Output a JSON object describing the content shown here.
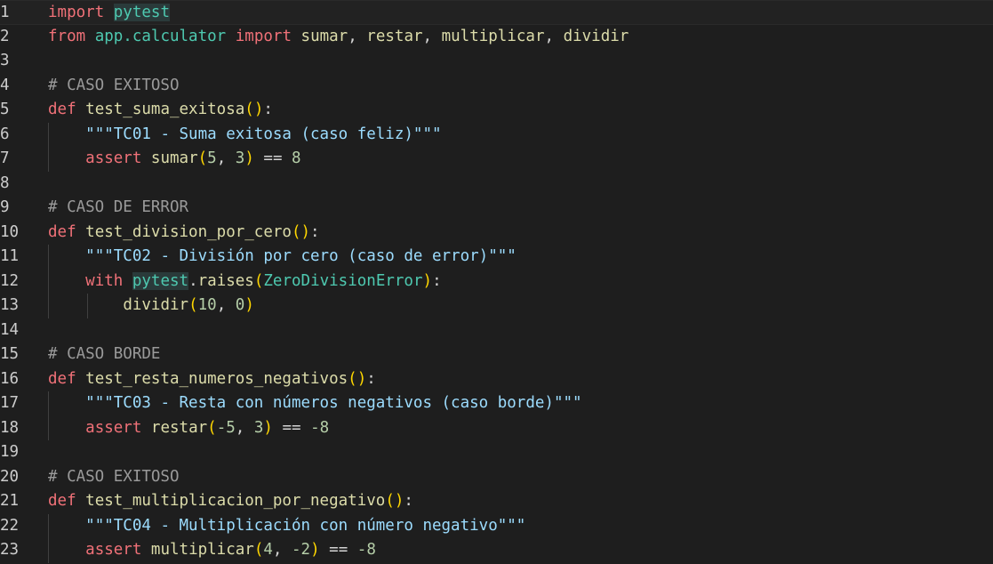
{
  "editor": {
    "lines": [
      {
        "n": "1",
        "tokens": [
          {
            "t": "import",
            "c": "kw"
          },
          {
            "t": " ",
            "c": "op"
          },
          {
            "t": "pytest",
            "c": "mod hl"
          }
        ]
      },
      {
        "n": "2",
        "tokens": [
          {
            "t": "from",
            "c": "kw"
          },
          {
            "t": " ",
            "c": "op"
          },
          {
            "t": "app.calculator",
            "c": "mod"
          },
          {
            "t": " ",
            "c": "op"
          },
          {
            "t": "import",
            "c": "kw"
          },
          {
            "t": " ",
            "c": "op"
          },
          {
            "t": "sumar",
            "c": "fn"
          },
          {
            "t": ", ",
            "c": "op"
          },
          {
            "t": "restar",
            "c": "fn"
          },
          {
            "t": ", ",
            "c": "op"
          },
          {
            "t": "multiplicar",
            "c": "fn"
          },
          {
            "t": ", ",
            "c": "op"
          },
          {
            "t": "dividir",
            "c": "fn"
          }
        ]
      },
      {
        "n": "3",
        "tokens": []
      },
      {
        "n": "4",
        "tokens": [
          {
            "t": "# CASO EXITOSO",
            "c": "cmt"
          }
        ]
      },
      {
        "n": "5",
        "tokens": [
          {
            "t": "def",
            "c": "kw"
          },
          {
            "t": " ",
            "c": "op"
          },
          {
            "t": "test_suma_exitosa",
            "c": "fn"
          },
          {
            "t": "()",
            "c": "paren"
          },
          {
            "t": ":",
            "c": "op"
          }
        ]
      },
      {
        "n": "6",
        "indent": 1,
        "tokens": [
          {
            "t": "\"\"\"TC01 - Suma exitosa (caso feliz)\"\"\"",
            "c": "doc"
          }
        ]
      },
      {
        "n": "7",
        "indent": 1,
        "tokens": [
          {
            "t": "assert",
            "c": "kw"
          },
          {
            "t": " ",
            "c": "op"
          },
          {
            "t": "sumar",
            "c": "fn"
          },
          {
            "t": "(",
            "c": "paren"
          },
          {
            "t": "5",
            "c": "num"
          },
          {
            "t": ", ",
            "c": "op"
          },
          {
            "t": "3",
            "c": "num"
          },
          {
            "t": ")",
            "c": "paren"
          },
          {
            "t": " == ",
            "c": "op"
          },
          {
            "t": "8",
            "c": "num"
          }
        ]
      },
      {
        "n": "8",
        "tokens": []
      },
      {
        "n": "9",
        "tokens": [
          {
            "t": "# CASO DE ERROR",
            "c": "cmt"
          }
        ]
      },
      {
        "n": "10",
        "tokens": [
          {
            "t": "def",
            "c": "kw"
          },
          {
            "t": " ",
            "c": "op"
          },
          {
            "t": "test_division_por_cero",
            "c": "fn"
          },
          {
            "t": "()",
            "c": "paren"
          },
          {
            "t": ":",
            "c": "op"
          }
        ]
      },
      {
        "n": "11",
        "indent": 1,
        "tokens": [
          {
            "t": "\"\"\"TC02 - División por cero (caso de error)\"\"\"",
            "c": "doc"
          }
        ]
      },
      {
        "n": "12",
        "indent": 1,
        "tokens": [
          {
            "t": "with",
            "c": "kw"
          },
          {
            "t": " ",
            "c": "op"
          },
          {
            "t": "pytest",
            "c": "mod hl"
          },
          {
            "t": ".",
            "c": "op"
          },
          {
            "t": "raises",
            "c": "fn"
          },
          {
            "t": "(",
            "c": "paren"
          },
          {
            "t": "ZeroDivisionError",
            "c": "cls"
          },
          {
            "t": ")",
            "c": "paren"
          },
          {
            "t": ":",
            "c": "op"
          }
        ]
      },
      {
        "n": "13",
        "indent": 2,
        "tokens": [
          {
            "t": "dividir",
            "c": "fn"
          },
          {
            "t": "(",
            "c": "paren"
          },
          {
            "t": "10",
            "c": "num"
          },
          {
            "t": ", ",
            "c": "op"
          },
          {
            "t": "0",
            "c": "num"
          },
          {
            "t": ")",
            "c": "paren"
          }
        ]
      },
      {
        "n": "14",
        "tokens": []
      },
      {
        "n": "15",
        "tokens": [
          {
            "t": "# CASO BORDE",
            "c": "cmt"
          }
        ]
      },
      {
        "n": "16",
        "tokens": [
          {
            "t": "def",
            "c": "kw"
          },
          {
            "t": " ",
            "c": "op"
          },
          {
            "t": "test_resta_numeros_negativos",
            "c": "fn"
          },
          {
            "t": "()",
            "c": "paren"
          },
          {
            "t": ":",
            "c": "op"
          }
        ]
      },
      {
        "n": "17",
        "indent": 1,
        "tokens": [
          {
            "t": "\"\"\"TC03 - Resta con números negativos (caso borde)\"\"\"",
            "c": "doc"
          }
        ]
      },
      {
        "n": "18",
        "indent": 1,
        "tokens": [
          {
            "t": "assert",
            "c": "kw"
          },
          {
            "t": " ",
            "c": "op"
          },
          {
            "t": "restar",
            "c": "fn"
          },
          {
            "t": "(",
            "c": "paren"
          },
          {
            "t": "-5",
            "c": "num"
          },
          {
            "t": ", ",
            "c": "op"
          },
          {
            "t": "3",
            "c": "num"
          },
          {
            "t": ")",
            "c": "paren"
          },
          {
            "t": " == ",
            "c": "op"
          },
          {
            "t": "-8",
            "c": "num"
          }
        ]
      },
      {
        "n": "19",
        "tokens": []
      },
      {
        "n": "20",
        "tokens": [
          {
            "t": "# CASO EXITOSO",
            "c": "cmt"
          }
        ]
      },
      {
        "n": "21",
        "tokens": [
          {
            "t": "def",
            "c": "kw"
          },
          {
            "t": " ",
            "c": "op"
          },
          {
            "t": "test_multiplicacion_por_negativo",
            "c": "fn"
          },
          {
            "t": "()",
            "c": "paren"
          },
          {
            "t": ":",
            "c": "op"
          }
        ]
      },
      {
        "n": "22",
        "indent": 1,
        "tokens": [
          {
            "t": "\"\"\"TC04 - Multiplicación con número negativo\"\"\"",
            "c": "doc"
          }
        ]
      },
      {
        "n": "23",
        "indent": 1,
        "tokens": [
          {
            "t": "assert",
            "c": "kw"
          },
          {
            "t": " ",
            "c": "op"
          },
          {
            "t": "multiplicar",
            "c": "fn"
          },
          {
            "t": "(",
            "c": "paren"
          },
          {
            "t": "4",
            "c": "num"
          },
          {
            "t": ", ",
            "c": "op"
          },
          {
            "t": "-2",
            "c": "num"
          },
          {
            "t": ")",
            "c": "paren"
          },
          {
            "t": " == ",
            "c": "op"
          },
          {
            "t": "-8",
            "c": "num"
          }
        ]
      }
    ]
  }
}
